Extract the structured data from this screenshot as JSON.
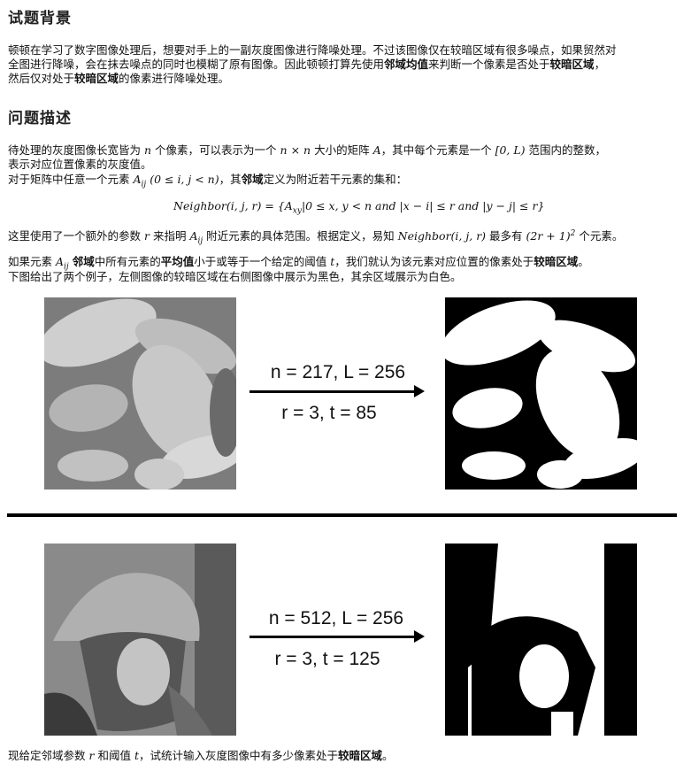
{
  "sections": {
    "background_title": "试题背景",
    "problem_title": "问题描述"
  },
  "background": {
    "line1": "顿顿在学习了数字图像处理后，想要对手上的一副灰度图像进行降噪处理。不过该图像仅在较暗区域有很多噪点，如果贸然对",
    "line2": "全图进行降噪，会在抹去噪点的同时也模糊了原有图像。因此顿顿打算先使用",
    "line2_b1": "邻域均值",
    "line2_mid": "来判断一个像素是否处于",
    "line2_b2": "较暗区域",
    "line2_end": "，",
    "line3_pre": "然后仅对处于",
    "line3_b": "较暗区域",
    "line3_end": "的像素进行降噪处理。"
  },
  "problem": {
    "p1_a": "待处理的灰度图像长宽皆为",
    "p1_n": "n",
    "p1_b": "个像素，可以表示为一个",
    "p1_nxn": "n × n",
    "p1_c": "大小的矩阵",
    "p1_A": "A",
    "p1_d": "，其中每个元素是一个",
    "p1_range": "[0, L)",
    "p1_e": "范围内的整数，",
    "p2": "表示对应位置像素的灰度值。",
    "p3_a": "对于矩阵中任意一个元素",
    "p3_Aij": "A",
    "p3_sub": "ij",
    "p3_cond": "(0 ≤ i, j < n)",
    "p3_b": "，其",
    "p3_bold": "邻域",
    "p3_c": "定义为附近若干元素的集和：",
    "formula": "Neighbor(i, j, r) = {A",
    "formula_sub": "xy",
    "formula_rest": "|0 ≤ x, y < n and |x − i| ≤ r and |y − j| ≤ r}",
    "p4_a": "这里使用了一个额外的参数",
    "p4_r": "r",
    "p4_b": "来指明",
    "p4_A": "A",
    "p4_sub": "ij",
    "p4_c": "附近元素的具体范围。根据定义，易知",
    "p4_nb": "Neighbor(i, j, r)",
    "p4_d": "最多有",
    "p4_cnt": "(2r + 1)",
    "p4_sup": "2",
    "p4_e": "个元素。",
    "p5_a": "如果元素",
    "p5_A": "A",
    "p5_sub": "ij",
    "p5_b1": "邻域",
    "p5_b": "中所有元素的",
    "p5_b2": "平均值",
    "p5_c": "小于或等于一个给定的阈值",
    "p5_t": "t",
    "p5_d": "，我们就认为该元素对应位置的像素处于",
    "p5_b3": "较暗区域",
    "p5_e": "。",
    "p6": "下图给出了两个例子，左侧图像的较暗区域在右侧图像中展示为黑色，其余区域展示为白色。"
  },
  "examples": [
    {
      "line1": "n = 217, L = 256",
      "line2": "r = 3, t = 85"
    },
    {
      "line1": "n = 512, L = 256",
      "line2": "r = 3, t = 125"
    }
  ],
  "final": {
    "a": "现给定邻域参数",
    "r": "r",
    "b": "和阈值",
    "t": "t",
    "c": "，试统计输入灰度图像中有多少像素处于",
    "bold": "较暗区域",
    "d": "。"
  }
}
